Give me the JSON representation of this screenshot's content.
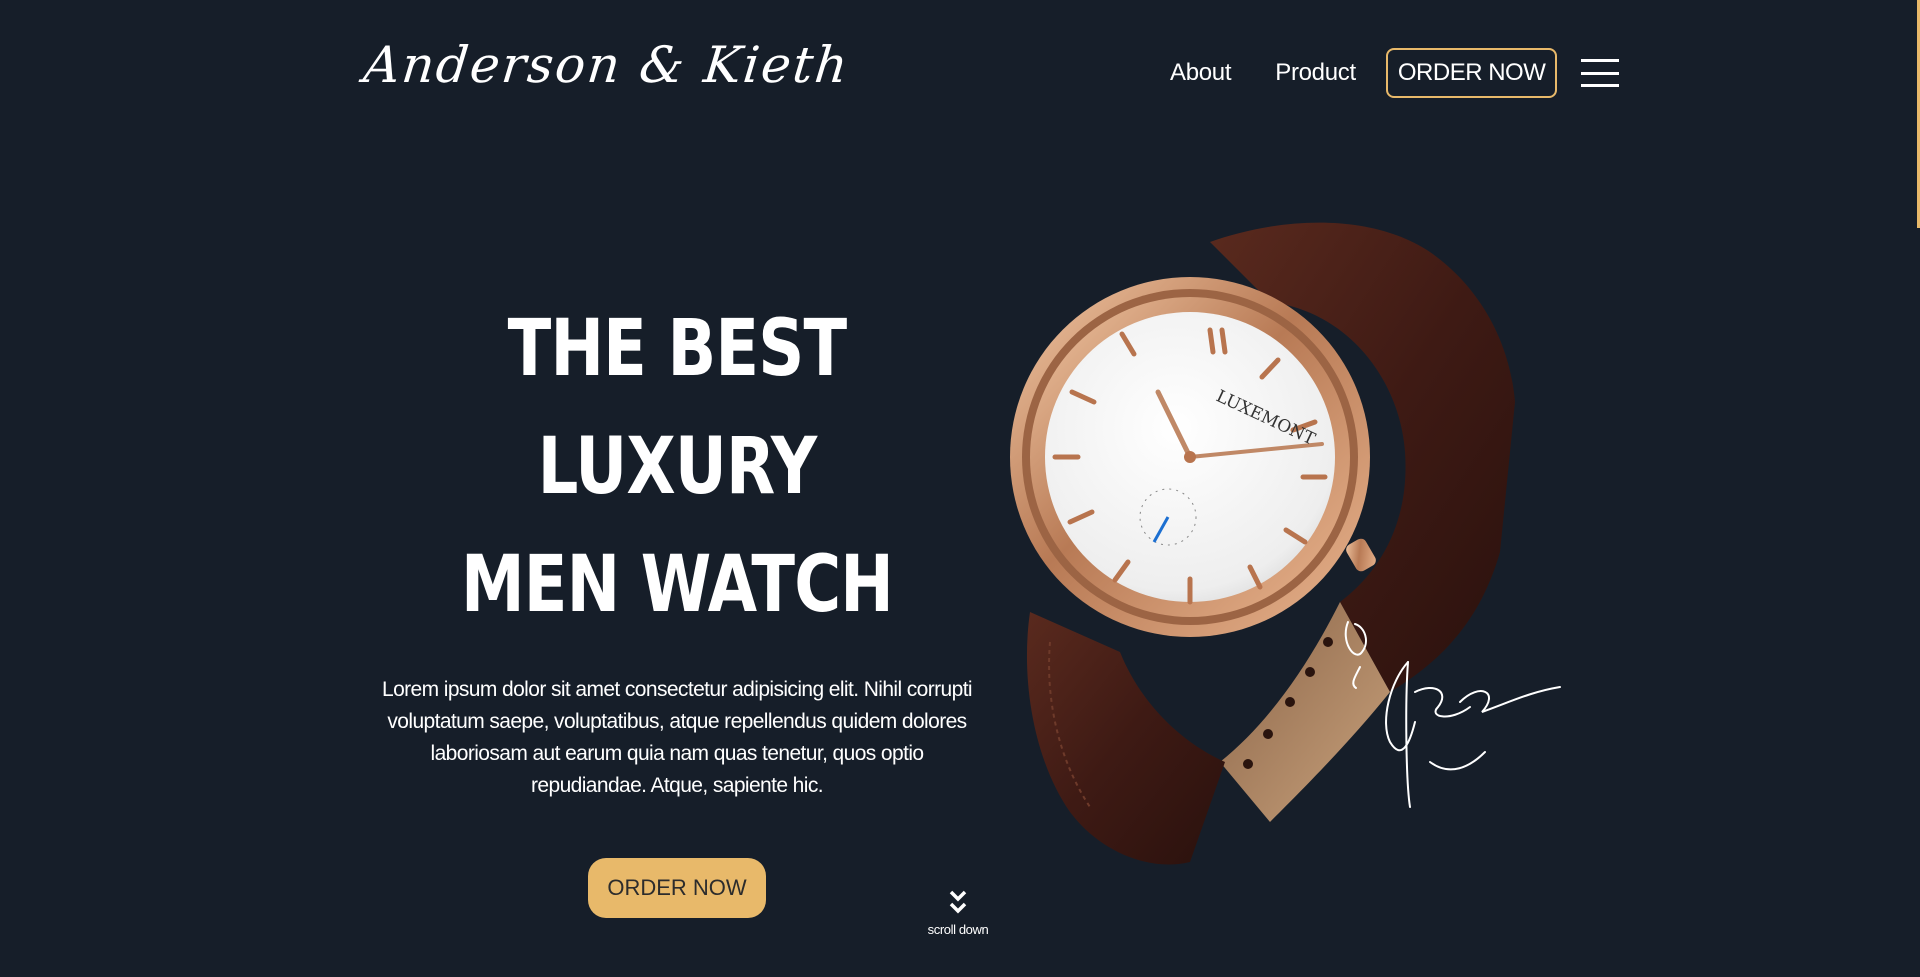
{
  "header": {
    "logo": "Anderson & Kieth",
    "nav": {
      "about": "About",
      "product": "Product",
      "order": "ORDER NOW"
    },
    "menu_icon": "hamburger-icon"
  },
  "hero": {
    "title_line1": "THE BEST LUXURY",
    "title_line2": "MEN WATCH",
    "description": "Lorem ipsum dolor sit amet consectetur adipisicing elit. Nihil corrupti voluptatum saepe, voluptatibus, atque repellendus quidem dolores laboriosam aut earum quia nam quas tenetur, quos optio repudiandae. Atque, sapiente hic.",
    "button": "ORDER NOW"
  },
  "product_image": {
    "dial_brand": "LUXEMONT",
    "image_name": "luxury-watch-image",
    "signature_icon": "signature-icon"
  },
  "scroll": {
    "label": "scroll down",
    "icon": "double-chevron-down-icon"
  },
  "colors": {
    "background": "#161e29",
    "accent": "#e8b96a",
    "text": "#ffffff"
  }
}
